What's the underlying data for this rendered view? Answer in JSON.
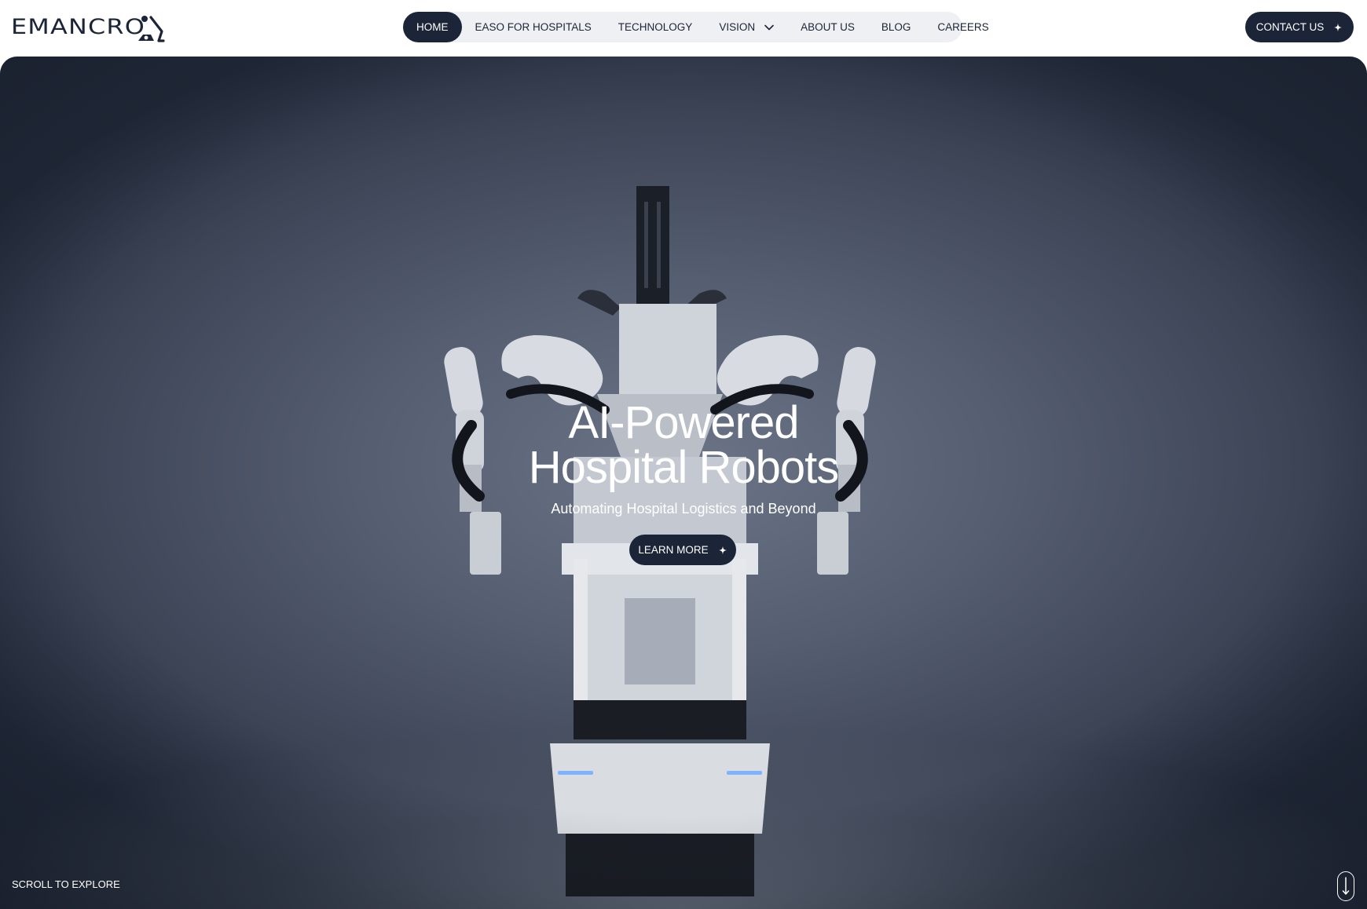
{
  "header": {
    "logo_text": "EMANCRO",
    "nav": [
      {
        "label": "HOME",
        "active": true
      },
      {
        "label": "EASO FOR HOSPITALS"
      },
      {
        "label": "TECHNOLOGY"
      },
      {
        "label": "VISION",
        "has_dropdown": true
      },
      {
        "label": "ABOUT US"
      },
      {
        "label": "BLOG"
      },
      {
        "label": "CAREERS"
      }
    ],
    "contact_label": "CONTACT US"
  },
  "hero": {
    "title_line1": "AI-Powered",
    "title_line2": "Hospital Robots",
    "subtitle": "Automating Hospital Logistics and Beyond",
    "cta_label": "LEARN MORE",
    "scroll_label": "SCROLL TO EXPLORE"
  },
  "icons": {
    "nav_dropdown": "chevron-down-icon",
    "button_accent": "sparkle-icon",
    "scroll": "arrow-down-icon"
  },
  "colors": {
    "primary": "#1c2438",
    "nav_bg": "#eff0f3",
    "text_on_dark": "#ffffff"
  }
}
